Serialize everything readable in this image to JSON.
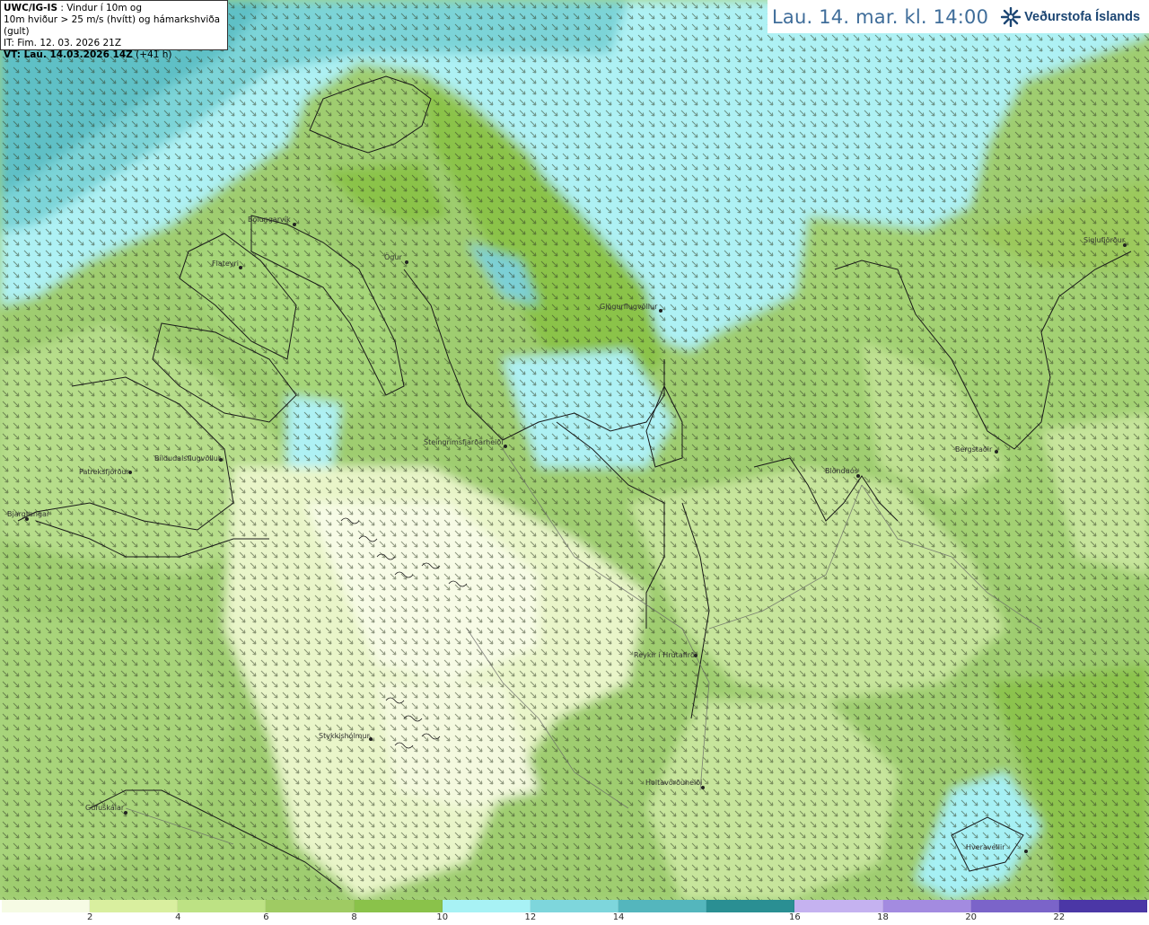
{
  "header": {
    "product": "UWC/IG-IS",
    "product_desc": " : Vindur í 10m og",
    "line2": "10m hviður > 25 m/s (hvítt) og hámarkshviða (gult)",
    "it_line": "IT: Fim. 12. 03. 2026 21Z",
    "vt_bold": "VT: Lau. 14.03.2026 14Z",
    "vt_rest": " (+41 h)"
  },
  "title": {
    "valid_time": "Lau. 14. mar. kl. 14:00",
    "brand": "Veðurstofa Íslands",
    "brand_icon": "snowflake-star-icon"
  },
  "places": [
    {
      "name": "Bolungarvík"
    },
    {
      "name": "Flateyri"
    },
    {
      "name": "Ögur"
    },
    {
      "name": "Gjögurflugvöllur"
    },
    {
      "name": "Siglufjörður"
    },
    {
      "name": "Patreksfjörður"
    },
    {
      "name": "Bíldudalsflugvöllur"
    },
    {
      "name": "Bjargtangar"
    },
    {
      "name": "Steingrímsfjarðarheiði"
    },
    {
      "name": "Blönduós"
    },
    {
      "name": "Bergstaðir"
    },
    {
      "name": "Reykir í Hrútafirði"
    },
    {
      "name": "Stykkishólmur"
    },
    {
      "name": "Holtavörðuheiði"
    },
    {
      "name": "Gufuskálar"
    },
    {
      "name": "Hveravellir"
    }
  ],
  "legend": {
    "colors": [
      "#f6fbe4",
      "#d9ef9f",
      "#bde284",
      "#9fcb63",
      "#8ac24a",
      "#a8f2f5",
      "#7ed6dc",
      "#54b6bd",
      "#2a8f93",
      "#c5b2f0",
      "#a38be0",
      "#7b64c9",
      "#4b37a6"
    ],
    "labels": [
      "2",
      "4",
      "6",
      "8",
      "10",
      "12",
      "14",
      "16",
      "18",
      "20",
      "22"
    ]
  }
}
